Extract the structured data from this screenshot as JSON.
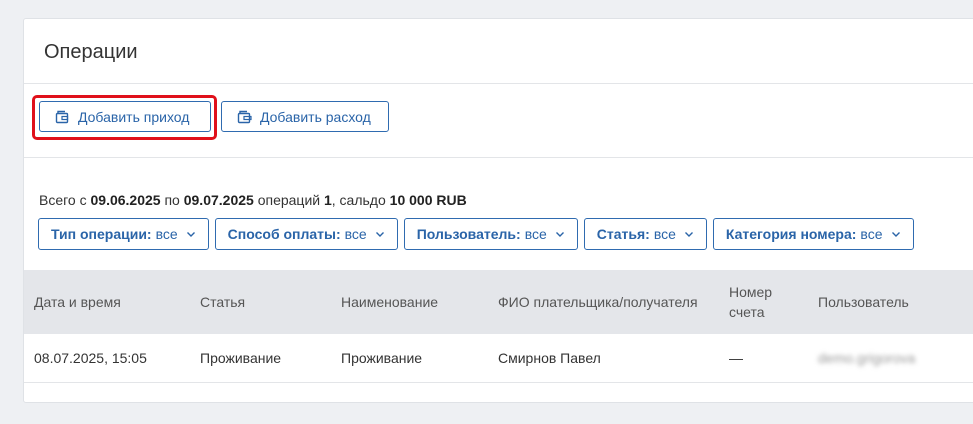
{
  "page": {
    "title": "Операции"
  },
  "toolbar": {
    "add_income_label": "Добавить приход",
    "add_expense_label": "Добавить расход"
  },
  "summary": {
    "prefix": "Всего с ",
    "date_from": "09.06.2025",
    "between": " по ",
    "date_to": "09.07.2025",
    "ops_label": " операций ",
    "ops_count": "1",
    "balance_label": ", сальдо ",
    "balance": "10 000 RUB"
  },
  "filters": [
    {
      "label": "Тип операции:",
      "value": "все"
    },
    {
      "label": "Способ оплаты:",
      "value": "все"
    },
    {
      "label": "Пользователь:",
      "value": "все"
    },
    {
      "label": "Статья:",
      "value": "все"
    },
    {
      "label": "Категория номера:",
      "value": "все"
    }
  ],
  "table": {
    "headers": {
      "datetime": "Дата и время",
      "article": "Статья",
      "name": "Наименование",
      "fio": "ФИО плательщика/получателя",
      "account": "Номер счета",
      "user": "Пользователь"
    },
    "rows": [
      {
        "datetime": "08.07.2025, 15:05",
        "article": "Проживание",
        "name": "Проживание",
        "fio": "Смирнов Павел",
        "account": "—",
        "user": "demo.grigorova"
      }
    ]
  },
  "icons": {
    "add_income": "wallet-in-icon",
    "add_expense": "wallet-out-icon",
    "dropdown": "chevron-down-icon"
  },
  "colors": {
    "accent": "#2a64a8",
    "highlight": "#e0101a",
    "table_header_bg": "#e4e6ea"
  }
}
